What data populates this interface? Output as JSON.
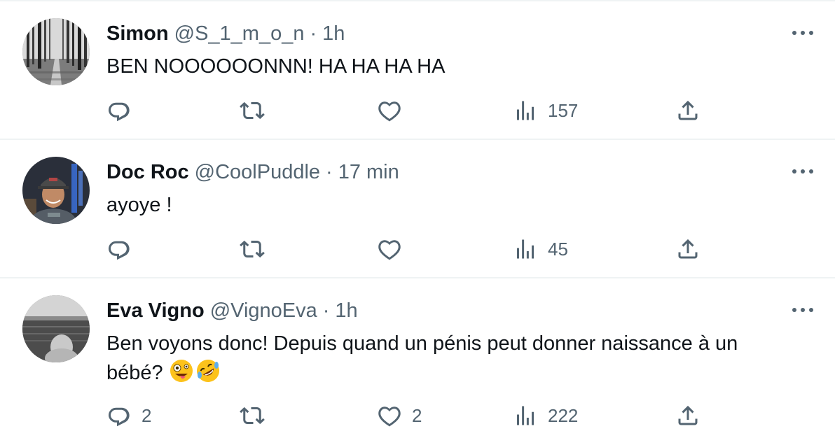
{
  "colors": {
    "text_primary": "#0f1419",
    "text_secondary": "#536471",
    "divider": "#eff3f4"
  },
  "icons": {
    "reply": "speech-bubble-icon",
    "retweet": "retweet-arrows-icon",
    "like": "heart-icon",
    "views": "bar-chart-icon",
    "share": "share-upload-icon",
    "more": "ellipsis-icon"
  },
  "tweets": [
    {
      "name": "Simon",
      "handle": "@S_1_m_o_n",
      "separator": "·",
      "time": "1h",
      "text": "BEN NOOOOOONNN! HA HA HA HA",
      "replies": "",
      "retweets": "",
      "likes": "",
      "views": "157"
    },
    {
      "name": "Doc Roc",
      "handle": "@CoolPuddle",
      "separator": "·",
      "time": "17 min",
      "text": "ayoye !",
      "replies": "",
      "retweets": "",
      "likes": "",
      "views": "45"
    },
    {
      "name": "Eva Vigno",
      "handle": "@VignoEva",
      "separator": "·",
      "time": "1h",
      "text_line1": "Ben voyons donc! Depuis quand un pénis peut donner naissance à un",
      "text_line2": "bébé?",
      "emojis": [
        "zany-face-emoji",
        "rolling-on-floor-laughing-emoji"
      ],
      "replies": "2",
      "retweets": "",
      "likes": "2",
      "views": "222"
    }
  ]
}
